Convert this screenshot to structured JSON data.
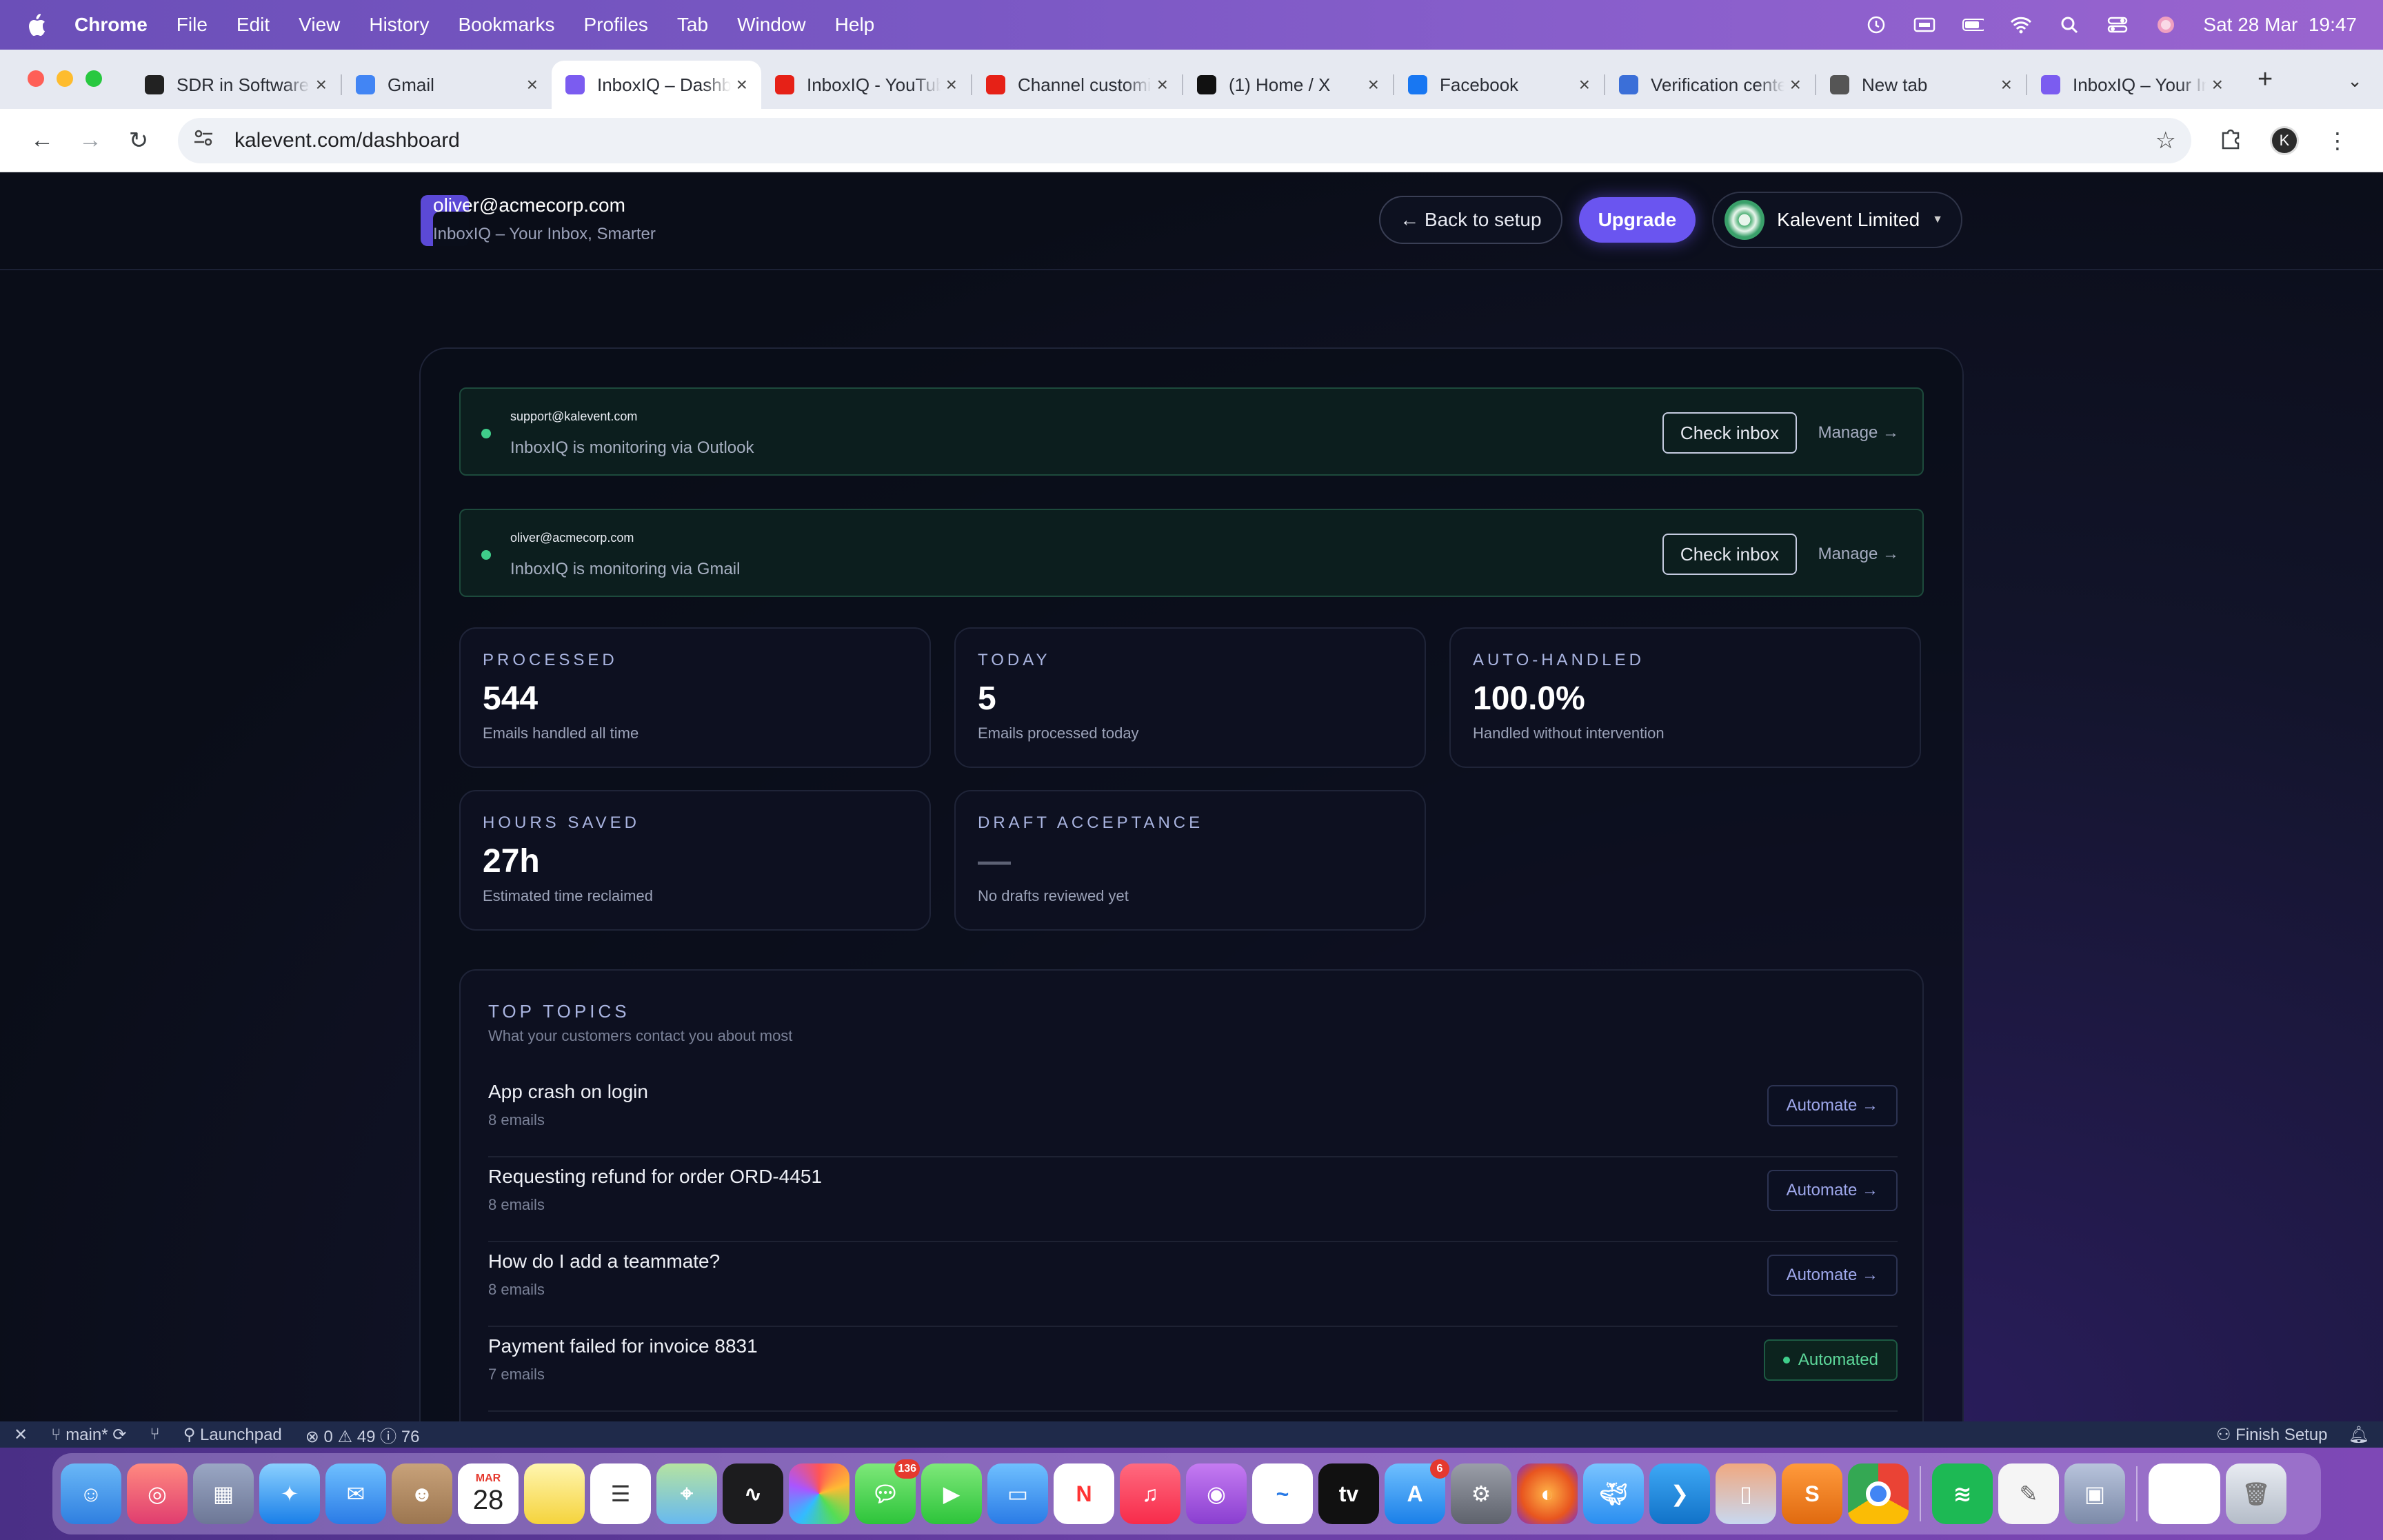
{
  "menubar": {
    "app": "Chrome",
    "items": [
      "File",
      "Edit",
      "View",
      "History",
      "Bookmarks",
      "Profiles",
      "Tab",
      "Window",
      "Help"
    ],
    "datetime": "Sat 28 Mar  19:47"
  },
  "tabs": [
    {
      "label": "SDR in Software",
      "icon": "openai-icon",
      "color": "#222222"
    },
    {
      "label": "Gmail",
      "icon": "google-icon",
      "color": "#4285f4"
    },
    {
      "label": "InboxIQ – Dashboard",
      "icon": "inboxiq-icon",
      "color": "#7b5cf0"
    },
    {
      "label": "InboxIQ - YouTube",
      "icon": "youtube-icon",
      "color": "#e62117"
    },
    {
      "label": "Channel customization",
      "icon": "youtube-icon",
      "color": "#e62117"
    },
    {
      "label": "(1) Home / X",
      "icon": "x-icon",
      "color": "#111111"
    },
    {
      "label": "Facebook",
      "icon": "facebook-icon",
      "color": "#1877f2"
    },
    {
      "label": "Verification center",
      "icon": "shield-icon",
      "color": "#3b6fd8"
    },
    {
      "label": "New tab",
      "icon": "chrome-icon",
      "color": "#555555"
    },
    {
      "label": "InboxIQ – Your Inbox",
      "icon": "inboxiq-icon",
      "color": "#7b5cf0"
    }
  ],
  "active_tab_index": 2,
  "omnibox": {
    "url": "kalevent.com/dashboard"
  },
  "header": {
    "email": "oliver@acmecorp.com",
    "tagline": "InboxIQ – Your Inbox, Smarter",
    "back_label": "← Back to setup",
    "upgrade_label": "Upgrade",
    "org_name": "Kalevent Limited"
  },
  "inboxes": [
    {
      "address": "support@kalevent.com",
      "status": "InboxIQ is monitoring via Outlook",
      "check_label": "Check inbox",
      "manage_label": "Manage →"
    },
    {
      "address": "oliver@acmecorp.com",
      "status": "InboxIQ is monitoring via Gmail",
      "check_label": "Check inbox",
      "manage_label": "Manage →"
    }
  ],
  "stats": [
    {
      "label": "PROCESSED",
      "value": "544",
      "sub": "Emails handled all time"
    },
    {
      "label": "TODAY",
      "value": "5",
      "sub": "Emails processed today"
    },
    {
      "label": "AUTO-HANDLED",
      "value": "100.0%",
      "sub": "Handled without intervention"
    },
    {
      "label": "HOURS SAVED",
      "value": "27h",
      "sub": "Estimated time reclaimed"
    },
    {
      "label": "DRAFT ACCEPTANCE",
      "value": "—",
      "sub": "No drafts reviewed yet"
    }
  ],
  "topics": {
    "title": "TOP TOPICS",
    "subtitle": "What your customers contact you about most",
    "items": [
      {
        "name": "App crash on login",
        "count": "8 emails",
        "action": "Automate →",
        "automated": false
      },
      {
        "name": "Requesting refund for order ORD-4451",
        "count": "8 emails",
        "action": "Automate →",
        "automated": false
      },
      {
        "name": "How do I add a teammate?",
        "count": "8 emails",
        "action": "Automate →",
        "automated": false
      },
      {
        "name": "Payment failed for invoice 8831",
        "count": "7 emails",
        "action": "Automated",
        "automated": true
      }
    ]
  },
  "statusbar": {
    "branch": "main*",
    "launchpad": "Launchpad",
    "errors": "0",
    "warnings": "49",
    "info": "76",
    "finish_setup": "Finish Setup"
  },
  "dock": {
    "calendar_month": "MAR",
    "calendar_day": "28",
    "messages_badge": "136",
    "appstore_badge": "6"
  }
}
